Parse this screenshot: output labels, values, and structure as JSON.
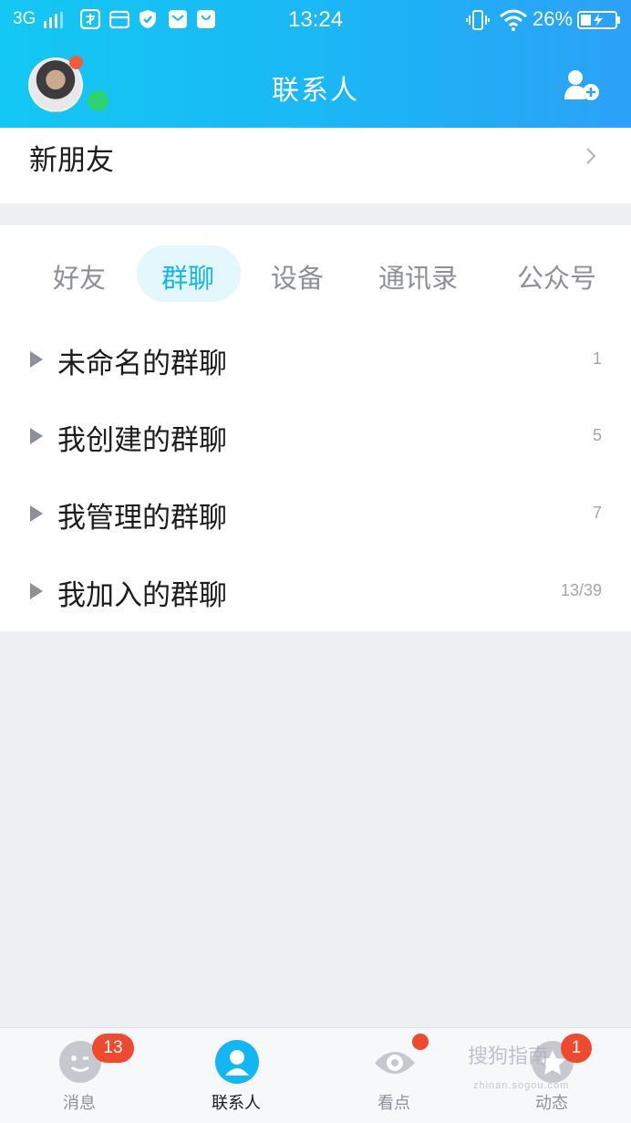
{
  "status_bar": {
    "network": "3G",
    "time": "13:24",
    "battery_pct": "26%"
  },
  "header": {
    "title": "联系人",
    "icons": [
      "avatar",
      "add-contact-icon"
    ],
    "accent": "#1ab8f5"
  },
  "new_friends": {
    "label": "新朋友"
  },
  "tabs": [
    {
      "label": "好友",
      "active": false
    },
    {
      "label": "群聊",
      "active": true
    },
    {
      "label": "设备",
      "active": false
    },
    {
      "label": "通讯录",
      "active": false
    },
    {
      "label": "公众号",
      "active": false
    }
  ],
  "groups": [
    {
      "name": "未命名的群聊",
      "count": "1"
    },
    {
      "name": "我创建的群聊",
      "count": "5"
    },
    {
      "name": "我管理的群聊",
      "count": "7"
    },
    {
      "name": "我加入的群聊",
      "count": "13/39"
    }
  ],
  "bottom_nav": [
    {
      "label": "消息",
      "badge": "13",
      "icon": "message-icon"
    },
    {
      "label": "联系人",
      "badge": "",
      "icon": "contacts-icon",
      "active": true
    },
    {
      "label": "看点",
      "badge": "",
      "icon": "eye-icon"
    },
    {
      "label": "动态",
      "badge": "1",
      "icon": "star-icon"
    }
  ],
  "watermark": {
    "text": "搜狗指南",
    "sub": "zhinan.sogou.com"
  }
}
